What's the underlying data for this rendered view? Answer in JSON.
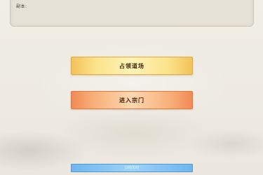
{
  "info_panel": {
    "text": "副本:"
  },
  "buttons": {
    "primary_label": "占领道场",
    "secondary_label": "进入宗门"
  },
  "progress_bar": {
    "label": "100/100",
    "fill_fraction": 1.0,
    "color": "#6fb6ee"
  },
  "colors": {
    "background": "#efece4",
    "gold_button": "#f3c25a",
    "orange_button": "#f28a55"
  }
}
